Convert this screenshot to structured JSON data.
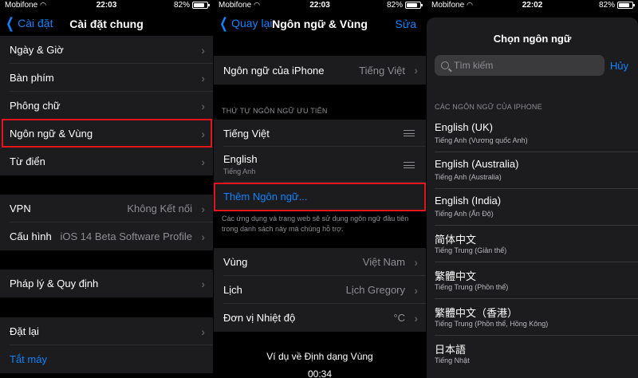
{
  "panel1": {
    "status": {
      "carrier": "Mobifone",
      "time": "22:03",
      "battery": "82%"
    },
    "nav": {
      "back": "Cài đặt",
      "title": "Cài đặt chung"
    },
    "rows": [
      {
        "label": "Ngày & Giờ"
      },
      {
        "label": "Bàn phím"
      },
      {
        "label": "Phông chữ"
      },
      {
        "label": "Ngôn ngữ & Vùng"
      },
      {
        "label": "Từ điển"
      },
      {
        "label": "VPN",
        "value": "Không Kết nối"
      },
      {
        "label": "Cấu hình",
        "value": "iOS 14 Beta Software Profile"
      },
      {
        "label": "Pháp lý & Quy định"
      },
      {
        "label": "Đặt lại"
      }
    ],
    "shutdown": "Tắt máy"
  },
  "panel2": {
    "status": {
      "carrier": "Mobifone",
      "time": "22:03",
      "battery": "82%"
    },
    "nav": {
      "back": "Quay lại",
      "title": "Ngôn ngữ & Vùng",
      "edit": "Sửa"
    },
    "iphone_lang": {
      "label": "Ngôn ngữ của iPhone",
      "value": "Tiếng Việt"
    },
    "pref_header": "THỨ TỰ NGÔN NGỮ ƯU TIÊN",
    "pref": [
      {
        "name": "Tiếng Việt",
        "sub": ""
      },
      {
        "name": "English",
        "sub": "Tiếng Anh"
      }
    ],
    "add": "Thêm Ngôn ngữ...",
    "footnote": "Các ứng dụng và trang web sẽ sử dụng ngôn ngữ đầu tiên trong danh sách này mà chúng hỗ trợ.",
    "region": {
      "label": "Vùng",
      "value": "Việt Nam"
    },
    "calendar": {
      "label": "Lịch",
      "value": "Lịch Gregory"
    },
    "temp": {
      "label": "Đơn vị Nhiệt độ",
      "value": "°C"
    },
    "example": "Ví dụ về Định dạng Vùng",
    "example_time": "00:34"
  },
  "panel3": {
    "status": {
      "carrier": "Mobifone",
      "time": "22:02",
      "battery": "82%"
    },
    "title": "Chọn ngôn ngữ",
    "search_placeholder": "Tìm kiếm",
    "cancel": "Hủy",
    "header": "CÁC NGÔN NGỮ CỦA IPHONE",
    "langs": [
      {
        "name": "English (UK)",
        "sub": "Tiếng Anh (Vương quốc Anh)"
      },
      {
        "name": "English (Australia)",
        "sub": "Tiếng Anh (Australia)"
      },
      {
        "name": "English (India)",
        "sub": "Tiếng Anh (Ấn Độ)"
      },
      {
        "name": "简体中文",
        "sub": "Tiếng Trung (Giản thể)"
      },
      {
        "name": "繁體中文",
        "sub": "Tiếng Trung (Phồn thể)"
      },
      {
        "name": "繁體中文（香港）",
        "sub": "Tiếng Trung (Phồn thể, Hồng Kông)"
      },
      {
        "name": "日本語",
        "sub": "Tiếng Nhật"
      }
    ]
  },
  "colors": {
    "accent": "#0a84ff",
    "highlight": "#e3151a",
    "cell": "#1c1c1e"
  }
}
